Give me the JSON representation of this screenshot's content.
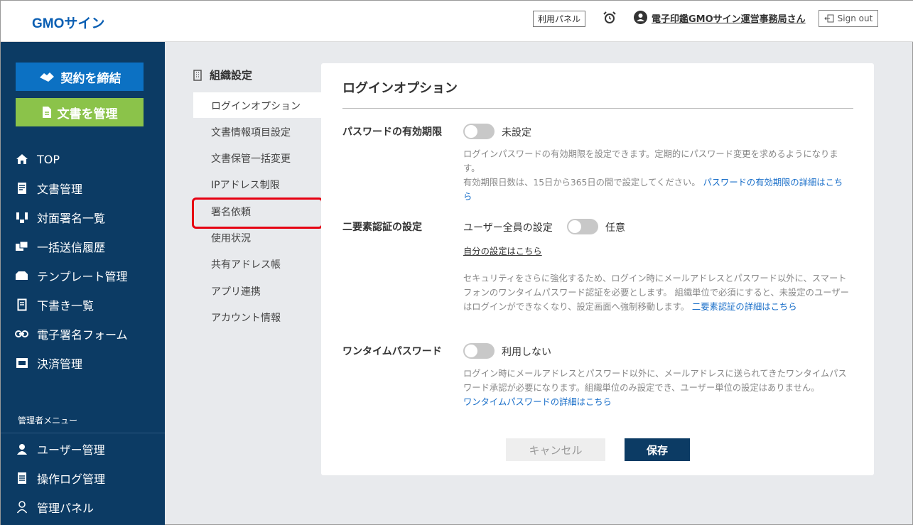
{
  "header": {
    "logo": "GMOサイン",
    "panel_button": "利用パネル",
    "user_name": "電子印鑑GMOサイン運営事務局さん",
    "signout": "Sign out"
  },
  "sidebar": {
    "contract_button": "契約を締結",
    "docs_button": "文書を管理",
    "items": [
      {
        "label": "TOP",
        "icon": "home-icon"
      },
      {
        "label": "文書管理",
        "icon": "document-icon"
      },
      {
        "label": "対面署名一覧",
        "icon": "face-to-face-icon"
      },
      {
        "label": "一括送信履歴",
        "icon": "bulk-send-icon"
      },
      {
        "label": "テンプレート管理",
        "icon": "template-icon"
      },
      {
        "label": "下書き一覧",
        "icon": "draft-icon"
      },
      {
        "label": "電子署名フォーム",
        "icon": "link-icon"
      },
      {
        "label": "決済管理",
        "icon": "pay-icon"
      }
    ],
    "admin_label": "管理者メニュー",
    "admin_items": [
      {
        "label": "ユーザー管理",
        "icon": "user-icon"
      },
      {
        "label": "操作ログ管理",
        "icon": "log-icon"
      },
      {
        "label": "管理パネル",
        "icon": "admin-panel-icon"
      }
    ]
  },
  "submenu": {
    "title": "組織設定",
    "items": [
      "ログインオプション",
      "文書情報項目設定",
      "文書保管一括変更",
      "IPアドレス制限",
      "署名依頼",
      "使用状況",
      "共有アドレス帳",
      "アプリ連携",
      "アカウント情報"
    ],
    "active": "ログインオプション"
  },
  "main": {
    "title": "ログインオプション",
    "password_expiry": {
      "label": "パスワードの有効期限",
      "toggle_value": "未設定",
      "desc1": "ログインパスワードの有効期限を設定できます。定期的にパスワード変更を求めるようになります。",
      "desc2": "有効期限日数は、15日から365日の間で設定してください。",
      "link": "パスワードの有効期限の詳細はこちら"
    },
    "two_factor": {
      "label": "二要素認証の設定",
      "all_users_label": "ユーザー全員の設定",
      "toggle_value": "任意",
      "self_link": "自分の設定はこちら",
      "desc": "セキュリティをさらに強化するため、ログイン時にメールアドレスとパスワード以外に、スマートフォンのワンタイムパスワード認証を必要とします。 組織単位で必須にすると、未設定のユーザーはログインができなくなり、設定画面へ強制移動します。",
      "link": "二要素認証の詳細はこちら"
    },
    "onetime": {
      "label": "ワンタイムパスワード",
      "toggle_value": "利用しない",
      "desc": "ログイン時にメールアドレスとパスワード以外に、メールアドレスに送られてきたワンタイムパスワード承認が必要になります。組織単位のみ設定でき、ユーザー単位の設定はありません。",
      "link": "ワンタイムパスワードの詳細はこちら"
    },
    "cancel": "キャンセル",
    "save": "保存"
  }
}
